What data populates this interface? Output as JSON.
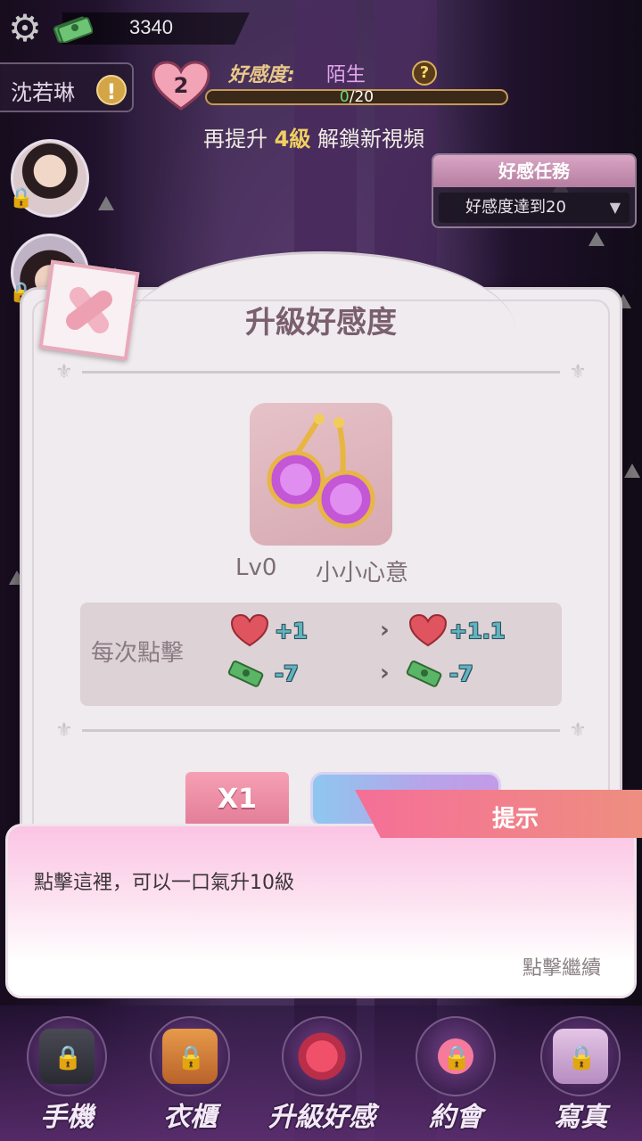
{
  "hud": {
    "money": "3340",
    "character_name": "沈若琳",
    "alert_symbol": "!",
    "affection_level": "2",
    "affection_label": "好感度:",
    "affection_status": "陌生",
    "help_symbol": "?",
    "progress_current": "0",
    "progress_rest": "/20",
    "progress_fraction": 0.0,
    "unlock_prefix": "再提升",
    "unlock_levels": "4級",
    "unlock_suffix": "解鎖新視頻"
  },
  "quest": {
    "title": "好感任務",
    "requirement": "好感度達到20"
  },
  "dialog": {
    "title": "升級好感度",
    "item_level": "Lv0",
    "item_name": "小小心意",
    "per_click_label": "每次點擊",
    "current_heart": "+1",
    "current_cost": "-7",
    "next_heart": "+1.1",
    "next_cost": "-7",
    "arrow": "›",
    "x1_label": "X1"
  },
  "tip": {
    "header": "提示",
    "message": "點擊這裡，可以一口氣升10級",
    "continue_label": "點擊繼續"
  },
  "nav": {
    "items": [
      {
        "label": "手機",
        "icon": "phone-icon"
      },
      {
        "label": "衣櫃",
        "icon": "wardrobe-icon"
      },
      {
        "label": "升級好感",
        "icon": "rose-icon"
      },
      {
        "label": "約會",
        "icon": "hearts-icon"
      },
      {
        "label": "寫真",
        "icon": "camera-icon"
      }
    ]
  },
  "colors": {
    "accent_pink": "#f56f98",
    "stat_teal": "#5fb4c0",
    "gold": "#f0d060"
  }
}
